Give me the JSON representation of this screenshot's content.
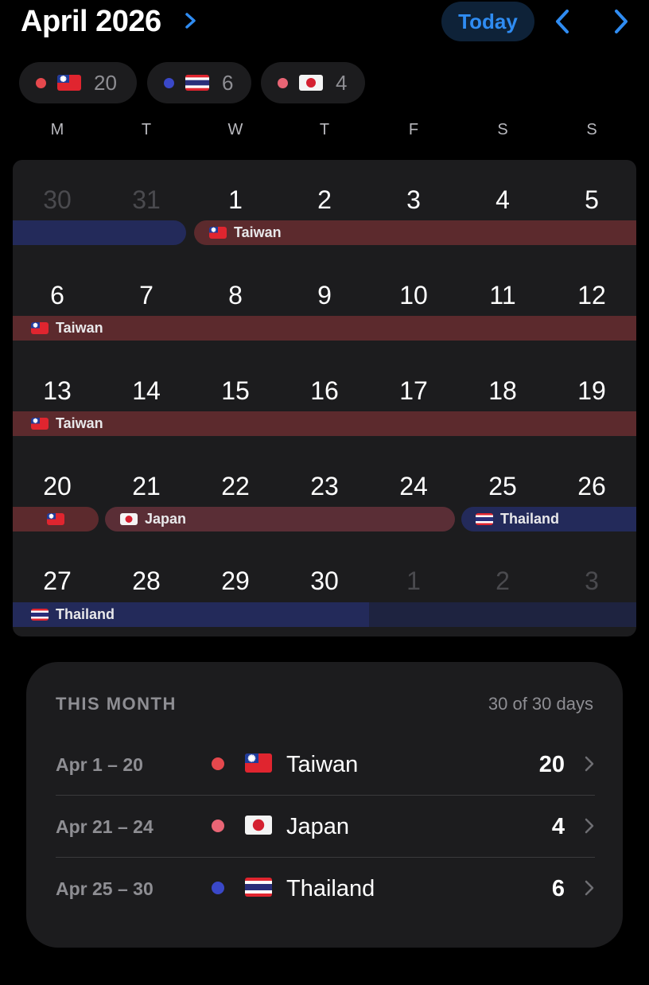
{
  "header": {
    "month_title": "April 2026",
    "today_label": "Today"
  },
  "summary": [
    {
      "dot_color": "#e5484d",
      "flag": "taiwan-flag",
      "count": "20"
    },
    {
      "dot_color": "#3a48c8",
      "flag": "thailand-flag",
      "count": "6"
    },
    {
      "dot_color": "#e86575",
      "flag": "japan-flag",
      "count": "4"
    }
  ],
  "weekdays": [
    "M",
    "T",
    "W",
    "T",
    "F",
    "S",
    "S"
  ],
  "weeks": [
    [
      "30",
      "31",
      "1",
      "2",
      "3",
      "4",
      "5"
    ],
    [
      "6",
      "7",
      "8",
      "9",
      "10",
      "11",
      "12"
    ],
    [
      "13",
      "14",
      "15",
      "16",
      "17",
      "18",
      "19"
    ],
    [
      "20",
      "21",
      "22",
      "23",
      "24",
      "25",
      "26"
    ],
    [
      "27",
      "28",
      "29",
      "30",
      "1",
      "2",
      "3"
    ]
  ],
  "bars": {
    "w1_taiwan": "Taiwan",
    "w2_taiwan": "Taiwan",
    "w3_taiwan": "Taiwan",
    "w4_japan": "Japan",
    "w4_thailand": "Thailand",
    "w5_thailand": "Thailand"
  },
  "this_month": {
    "title": "THIS MONTH",
    "subtitle": "30 of 30 days",
    "trips": [
      {
        "range": "Apr 1 – 20",
        "dot_color": "#e5484d",
        "flag": "taiwan-flag",
        "country": "Taiwan",
        "days": "20"
      },
      {
        "range": "Apr 21 – 24",
        "dot_color": "#e86575",
        "flag": "japan-flag",
        "country": "Japan",
        "days": "4"
      },
      {
        "range": "Apr 25 – 30",
        "dot_color": "#3a48c8",
        "flag": "thailand-flag",
        "country": "Thailand",
        "days": "6"
      }
    ]
  },
  "colors": {
    "accent": "#2f8cf2",
    "taiwan_bar": "#5c2a2d",
    "japan_bar": "#5a2e36",
    "thailand_bar": "#232a5a"
  }
}
